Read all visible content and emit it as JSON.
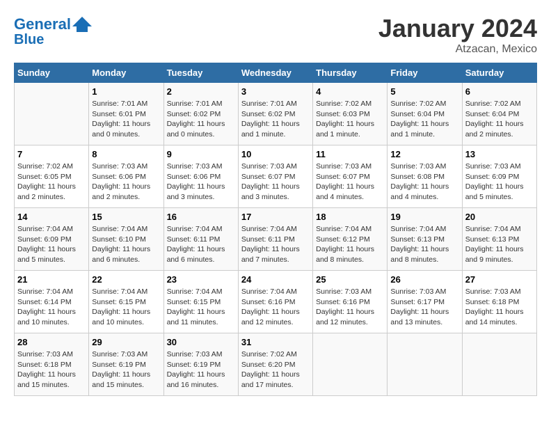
{
  "header": {
    "logo_line1": "General",
    "logo_line2": "Blue",
    "month": "January 2024",
    "location": "Atzacan, Mexico"
  },
  "days_of_week": [
    "Sunday",
    "Monday",
    "Tuesday",
    "Wednesday",
    "Thursday",
    "Friday",
    "Saturday"
  ],
  "weeks": [
    [
      {
        "num": "",
        "info": ""
      },
      {
        "num": "1",
        "info": "Sunrise: 7:01 AM\nSunset: 6:01 PM\nDaylight: 11 hours\nand 0 minutes."
      },
      {
        "num": "2",
        "info": "Sunrise: 7:01 AM\nSunset: 6:02 PM\nDaylight: 11 hours\nand 0 minutes."
      },
      {
        "num": "3",
        "info": "Sunrise: 7:01 AM\nSunset: 6:02 PM\nDaylight: 11 hours\nand 1 minute."
      },
      {
        "num": "4",
        "info": "Sunrise: 7:02 AM\nSunset: 6:03 PM\nDaylight: 11 hours\nand 1 minute."
      },
      {
        "num": "5",
        "info": "Sunrise: 7:02 AM\nSunset: 6:04 PM\nDaylight: 11 hours\nand 1 minute."
      },
      {
        "num": "6",
        "info": "Sunrise: 7:02 AM\nSunset: 6:04 PM\nDaylight: 11 hours\nand 2 minutes."
      }
    ],
    [
      {
        "num": "7",
        "info": "Sunrise: 7:02 AM\nSunset: 6:05 PM\nDaylight: 11 hours\nand 2 minutes."
      },
      {
        "num": "8",
        "info": "Sunrise: 7:03 AM\nSunset: 6:06 PM\nDaylight: 11 hours\nand 2 minutes."
      },
      {
        "num": "9",
        "info": "Sunrise: 7:03 AM\nSunset: 6:06 PM\nDaylight: 11 hours\nand 3 minutes."
      },
      {
        "num": "10",
        "info": "Sunrise: 7:03 AM\nSunset: 6:07 PM\nDaylight: 11 hours\nand 3 minutes."
      },
      {
        "num": "11",
        "info": "Sunrise: 7:03 AM\nSunset: 6:07 PM\nDaylight: 11 hours\nand 4 minutes."
      },
      {
        "num": "12",
        "info": "Sunrise: 7:03 AM\nSunset: 6:08 PM\nDaylight: 11 hours\nand 4 minutes."
      },
      {
        "num": "13",
        "info": "Sunrise: 7:03 AM\nSunset: 6:09 PM\nDaylight: 11 hours\nand 5 minutes."
      }
    ],
    [
      {
        "num": "14",
        "info": "Sunrise: 7:04 AM\nSunset: 6:09 PM\nDaylight: 11 hours\nand 5 minutes."
      },
      {
        "num": "15",
        "info": "Sunrise: 7:04 AM\nSunset: 6:10 PM\nDaylight: 11 hours\nand 6 minutes."
      },
      {
        "num": "16",
        "info": "Sunrise: 7:04 AM\nSunset: 6:11 PM\nDaylight: 11 hours\nand 6 minutes."
      },
      {
        "num": "17",
        "info": "Sunrise: 7:04 AM\nSunset: 6:11 PM\nDaylight: 11 hours\nand 7 minutes."
      },
      {
        "num": "18",
        "info": "Sunrise: 7:04 AM\nSunset: 6:12 PM\nDaylight: 11 hours\nand 8 minutes."
      },
      {
        "num": "19",
        "info": "Sunrise: 7:04 AM\nSunset: 6:13 PM\nDaylight: 11 hours\nand 8 minutes."
      },
      {
        "num": "20",
        "info": "Sunrise: 7:04 AM\nSunset: 6:13 PM\nDaylight: 11 hours\nand 9 minutes."
      }
    ],
    [
      {
        "num": "21",
        "info": "Sunrise: 7:04 AM\nSunset: 6:14 PM\nDaylight: 11 hours\nand 10 minutes."
      },
      {
        "num": "22",
        "info": "Sunrise: 7:04 AM\nSunset: 6:15 PM\nDaylight: 11 hours\nand 10 minutes."
      },
      {
        "num": "23",
        "info": "Sunrise: 7:04 AM\nSunset: 6:15 PM\nDaylight: 11 hours\nand 11 minutes."
      },
      {
        "num": "24",
        "info": "Sunrise: 7:04 AM\nSunset: 6:16 PM\nDaylight: 11 hours\nand 12 minutes."
      },
      {
        "num": "25",
        "info": "Sunrise: 7:03 AM\nSunset: 6:16 PM\nDaylight: 11 hours\nand 12 minutes."
      },
      {
        "num": "26",
        "info": "Sunrise: 7:03 AM\nSunset: 6:17 PM\nDaylight: 11 hours\nand 13 minutes."
      },
      {
        "num": "27",
        "info": "Sunrise: 7:03 AM\nSunset: 6:18 PM\nDaylight: 11 hours\nand 14 minutes."
      }
    ],
    [
      {
        "num": "28",
        "info": "Sunrise: 7:03 AM\nSunset: 6:18 PM\nDaylight: 11 hours\nand 15 minutes."
      },
      {
        "num": "29",
        "info": "Sunrise: 7:03 AM\nSunset: 6:19 PM\nDaylight: 11 hours\nand 15 minutes."
      },
      {
        "num": "30",
        "info": "Sunrise: 7:03 AM\nSunset: 6:19 PM\nDaylight: 11 hours\nand 16 minutes."
      },
      {
        "num": "31",
        "info": "Sunrise: 7:02 AM\nSunset: 6:20 PM\nDaylight: 11 hours\nand 17 minutes."
      },
      {
        "num": "",
        "info": ""
      },
      {
        "num": "",
        "info": ""
      },
      {
        "num": "",
        "info": ""
      }
    ]
  ]
}
